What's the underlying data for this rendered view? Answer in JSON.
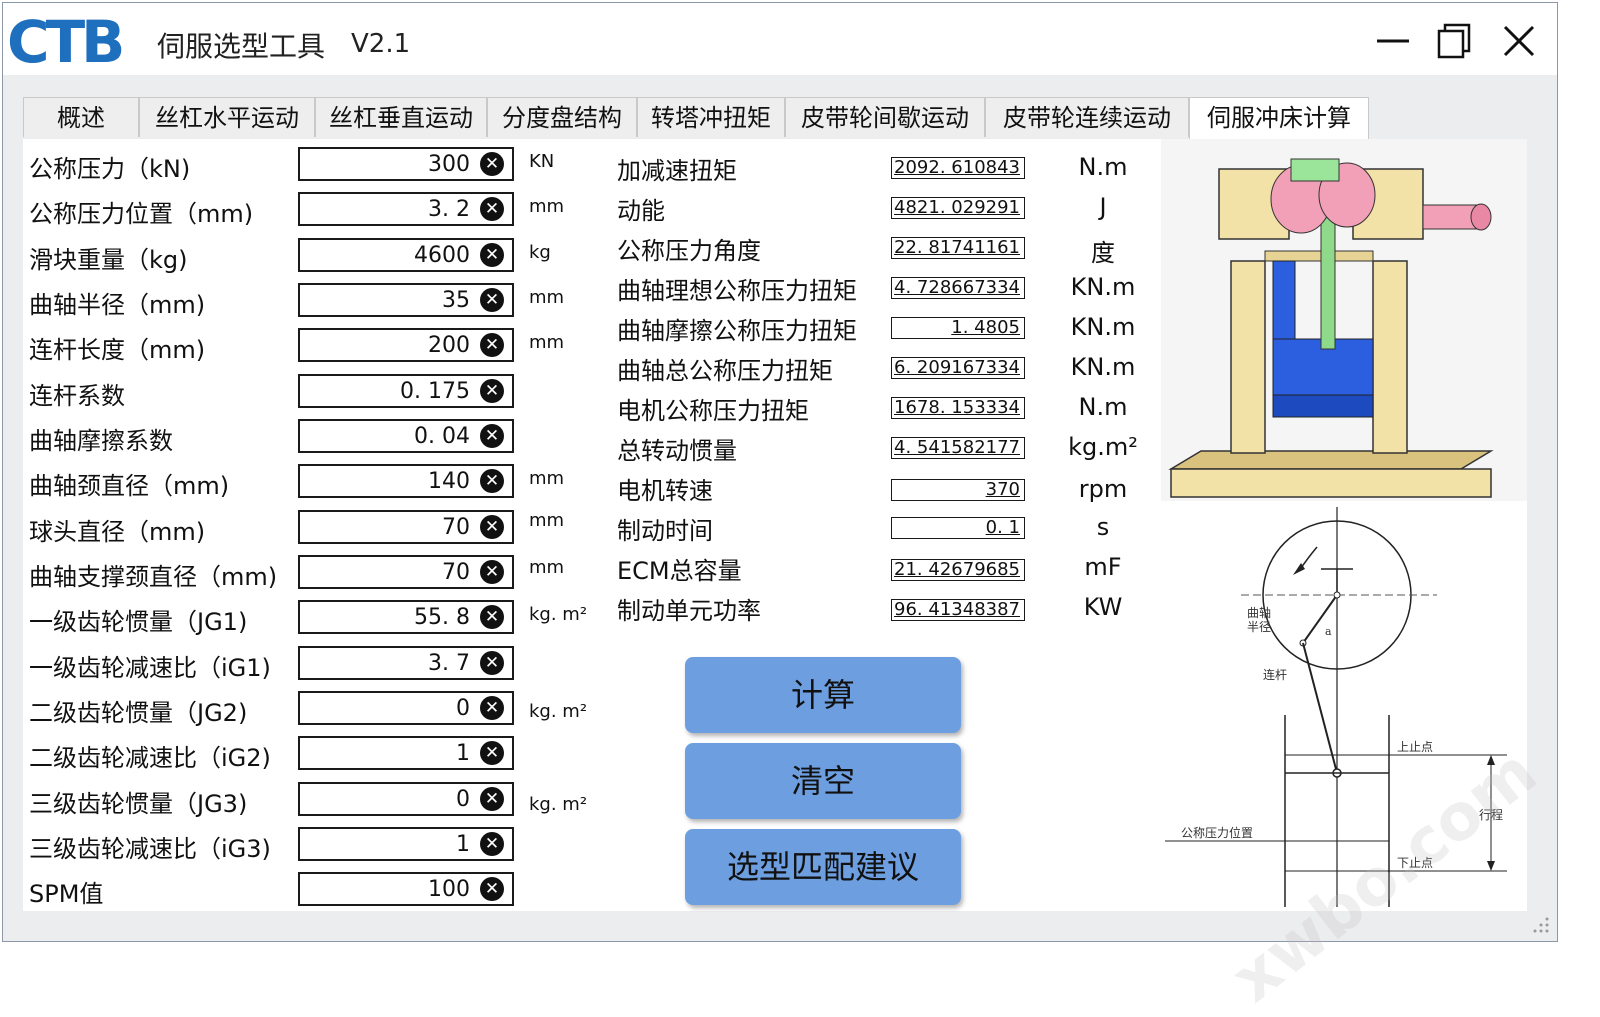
{
  "window": {
    "logo": "CTB",
    "title": "伺服选型工具",
    "version": "V2.1"
  },
  "tabs": [
    "概述",
    "丝杠水平运动",
    "丝杠垂直运动",
    "分度盘结构",
    "转塔冲扭矩",
    "皮带轮间歇运动",
    "皮带轮连续运动",
    "伺服冲床计算"
  ],
  "active_tab": "伺服冲床计算",
  "params": [
    {
      "label": "公称压力（kN)",
      "value": "300",
      "unit": "KN"
    },
    {
      "label": "公称压力位置（mm)",
      "value": "3. 2",
      "unit": "mm"
    },
    {
      "label": "滑块重量（kg)",
      "value": "4600",
      "unit": "kg"
    },
    {
      "label": "曲轴半径（mm)",
      "value": "35",
      "unit": "mm"
    },
    {
      "label": "连杆长度（mm)",
      "value": "200",
      "unit": "mm"
    },
    {
      "label": "连杆系数",
      "value": "0. 175",
      "unit": ""
    },
    {
      "label": "曲轴摩擦系数",
      "value": "0. 04",
      "unit": ""
    },
    {
      "label": "曲轴颈直径（mm)",
      "value": "140",
      "unit": "mm"
    },
    {
      "label": "球头直径（mm)",
      "value": "70",
      "unit": "mm"
    },
    {
      "label": "曲轴支撑颈直径（mm)",
      "value": "70",
      "unit": "mm"
    },
    {
      "label": "一级齿轮惯量（JG1)",
      "value": "55. 8",
      "unit": "kg. m²"
    },
    {
      "label": "一级齿轮减速比（iG1)",
      "value": "3. 7",
      "unit": ""
    },
    {
      "label": "二级齿轮惯量（JG2)",
      "value": "0",
      "unit": "kg. m²"
    },
    {
      "label": "二级齿轮减速比（iG2)",
      "value": "1",
      "unit": ""
    },
    {
      "label": "三级齿轮惯量（JG3)",
      "value": "0",
      "unit": "kg. m²"
    },
    {
      "label": "三级齿轮减速比（iG3)",
      "value": "1",
      "unit": ""
    },
    {
      "label": "SPM值",
      "value": "100",
      "unit": ""
    }
  ],
  "results": [
    {
      "label": "加减速扭矩",
      "value": "2092. 610843",
      "unit": "N.m"
    },
    {
      "label": "动能",
      "value": "4821. 029291",
      "unit": "J"
    },
    {
      "label": "公称压力角度",
      "value": "22. 81741161",
      "unit": "度"
    },
    {
      "label": "曲轴理想公称压力扭矩",
      "value": "4. 728667334",
      "unit": "KN.m"
    },
    {
      "label": "曲轴摩擦公称压力扭矩",
      "value": "1. 4805",
      "unit": "KN.m"
    },
    {
      "label": "曲轴总公称压力扭矩",
      "value": "6. 209167334",
      "unit": "KN.m"
    },
    {
      "label": "电机公称压力扭矩",
      "value": "1678. 153334",
      "unit": "N.m"
    },
    {
      "label": "总转动惯量",
      "value": "4. 541582177",
      "unit": "kg.m²"
    },
    {
      "label": "电机转速",
      "value": "370",
      "unit": "rpm"
    },
    {
      "label": "制动时间",
      "value": "0. 1",
      "unit": "s"
    },
    {
      "label": "ECM总容量",
      "value": "21. 42679685",
      "unit": "mF"
    },
    {
      "label": "制动单元功率",
      "value": "96. 41348387",
      "unit": "KW"
    }
  ],
  "buttons": {
    "calc": "计算",
    "clear": "清空",
    "suggest": "选型匹配建议"
  },
  "diagram": {
    "crank_radius": "曲轴\n半径",
    "angle": "a",
    "rod": "连杆",
    "tdc": "上止点",
    "stroke": "行程",
    "nominal_pos": "公称压力位置",
    "bdc": "下止点"
  },
  "watermark": "xwbo.com"
}
